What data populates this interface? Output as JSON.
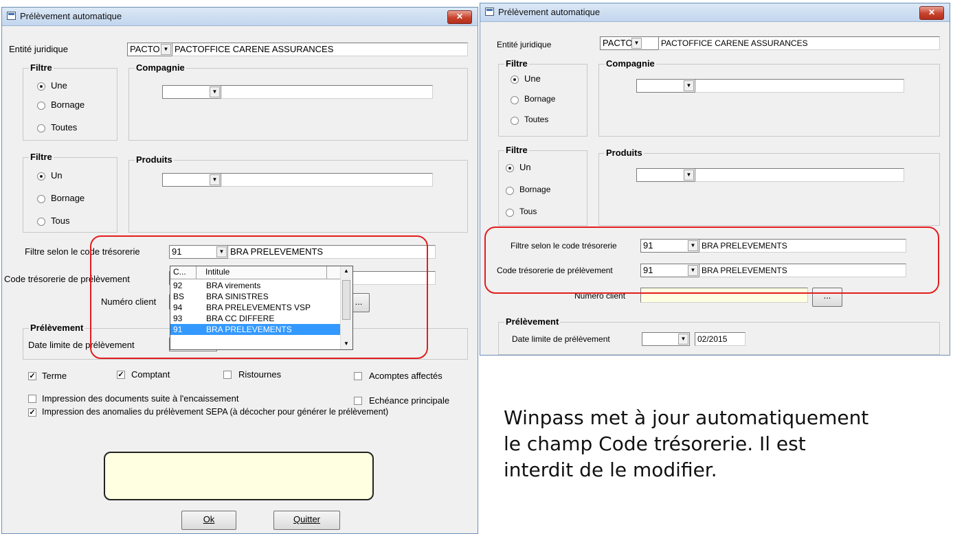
{
  "left_window": {
    "title": "Prélèvement automatique",
    "close_label": "✕",
    "entite_label": "Entité juridique",
    "entite_code": "PACTO",
    "entite_name": "PACTOFFICE CARENE ASSURANCES",
    "filtre1_title": "Filtre",
    "filtre1_options": [
      "Une",
      "Bornage",
      "Toutes"
    ],
    "compagnie_title": "Compagnie",
    "filtre2_title": "Filtre",
    "filtre2_options": [
      "Un",
      "Bornage",
      "Tous"
    ],
    "produits_title": "Produits",
    "filtre_code_label": "Filtre selon le code trésorerie",
    "filtre_code_value": "91",
    "filtre_code_name": "BRA  PRELEVEMENTS",
    "code_prelevement_label": "Code trésorerie de prélèvement",
    "numero_client_label": "Numéro client",
    "ellipsis": "...",
    "prelevement_title": "Prélèvement",
    "date_limite_label": "Date  limite de prélèvement",
    "dropdown": {
      "headers": [
        "C...",
        "Intitule"
      ],
      "rows": [
        {
          "code": "92",
          "label": "BRA virements"
        },
        {
          "code": "BS",
          "label": "BRA SINISTRES"
        },
        {
          "code": "94",
          "label": "BRA PRELEVEMENTS VSP"
        },
        {
          "code": "93",
          "label": "BRA CC DIFFERE"
        },
        {
          "code": "91",
          "label": "BRA  PRELEVEMENTS"
        }
      ],
      "selected_index": 4
    },
    "checkboxes": {
      "terme": "Terme",
      "comptant": "Comptant",
      "ristournes": "Ristournes",
      "acomptes": "Acomptes affectés",
      "impression_docs": "Impression des documents suite à l'encaissement",
      "echeance": "Echéance principale",
      "impression_anomalies": "Impression des anomalies du prélèvement SEPA (à décocher pour générer le prélèvement)"
    },
    "ok_label": "Ok",
    "quitter_label": "Quitter"
  },
  "right_window": {
    "title": "Prélèvement automatique",
    "close_label": "✕",
    "entite_label": "Entité juridique",
    "entite_code": "PACTO",
    "entite_name": "PACTOFFICE CARENE ASSURANCES",
    "filtre1_title": "Filtre",
    "filtre1_options": [
      "Une",
      "Bornage",
      "Toutes"
    ],
    "compagnie_title": "Compagnie",
    "filtre2_title": "Filtre",
    "filtre2_options": [
      "Un",
      "Bornage",
      "Tous"
    ],
    "produits_title": "Produits",
    "filtre_code_label": "Filtre selon le code trésorerie",
    "filtre_code_value": "91",
    "filtre_code_name": "BRA  PRELEVEMENTS",
    "code_prelevement_label": "Code trésorerie de prélèvement",
    "code_prelevement_value": "91",
    "code_prelevement_name": "BRA  PRELEVEMENTS",
    "numero_client_label": "Numéro client",
    "ellipsis": "...",
    "prelevement_title": "Prélèvement",
    "date_limite_label": "Date  limite de prélèvement",
    "date_value": "02/2015"
  },
  "note": {
    "line1": "Winpass met à jour automatiquement",
    "line2": "le champ Code trésorerie. Il est",
    "line3": "interdit de le modifier."
  },
  "colors": {
    "highlight_border": "#e31c1c",
    "selection": "#3399ff",
    "yellow_field": "#ffffe1"
  }
}
